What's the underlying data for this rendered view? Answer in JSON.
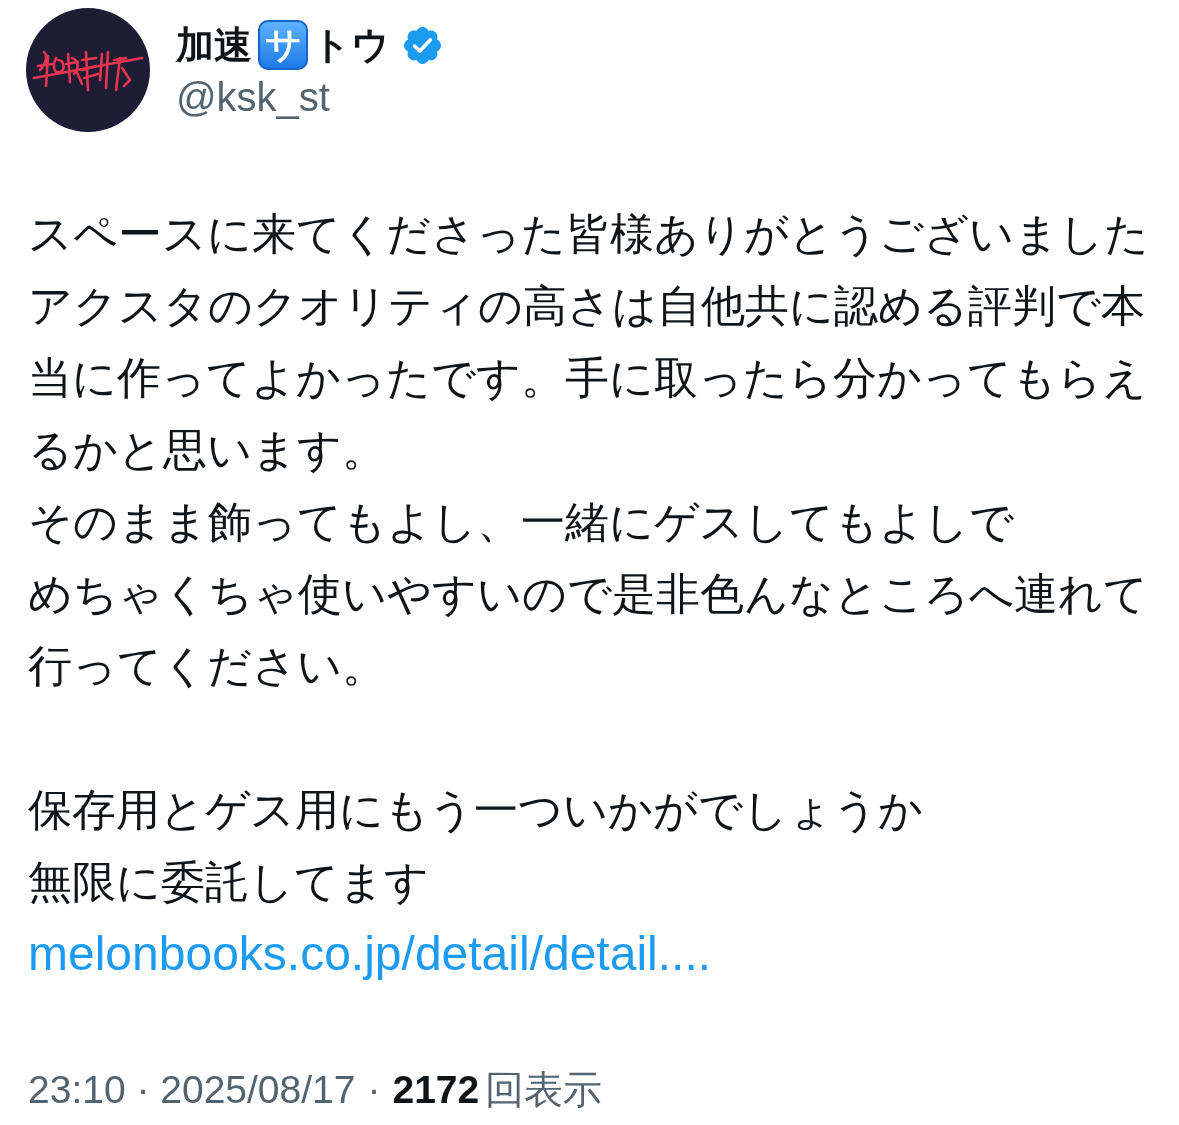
{
  "author": {
    "name_segments": [
      {
        "kind": "plain",
        "text": "加速"
      },
      {
        "kind": "emoji",
        "text": "サ"
      },
      {
        "kind": "plain",
        "text": "トウ"
      }
    ],
    "verified": true,
    "handle": "@ksk_st"
  },
  "tweet": {
    "paragraphs": [
      {
        "lines": [
          "スペースに来てくださった皆様ありがとうございました",
          "アクスタのクオリティの高さは自他共に認める評判で本当に作ってよかったです。手に取ったら分かってもらえるかと思います。",
          "そのまま飾ってもよし、一緒にゲスしてもよしで",
          "めちゃくちゃ使いやすいので是非色んなところへ連れて行ってください。"
        ]
      },
      {
        "lines": [
          "保存用とゲス用にもう一ついかがでしょうか",
          "無限に委託してます"
        ]
      }
    ],
    "link": "melonbooks.co.jp/detail/detail...."
  },
  "footer": {
    "timestamp": "23:10 · 2025/08/17",
    "separator": "·",
    "views": "2172",
    "views_label": "回表示"
  }
}
